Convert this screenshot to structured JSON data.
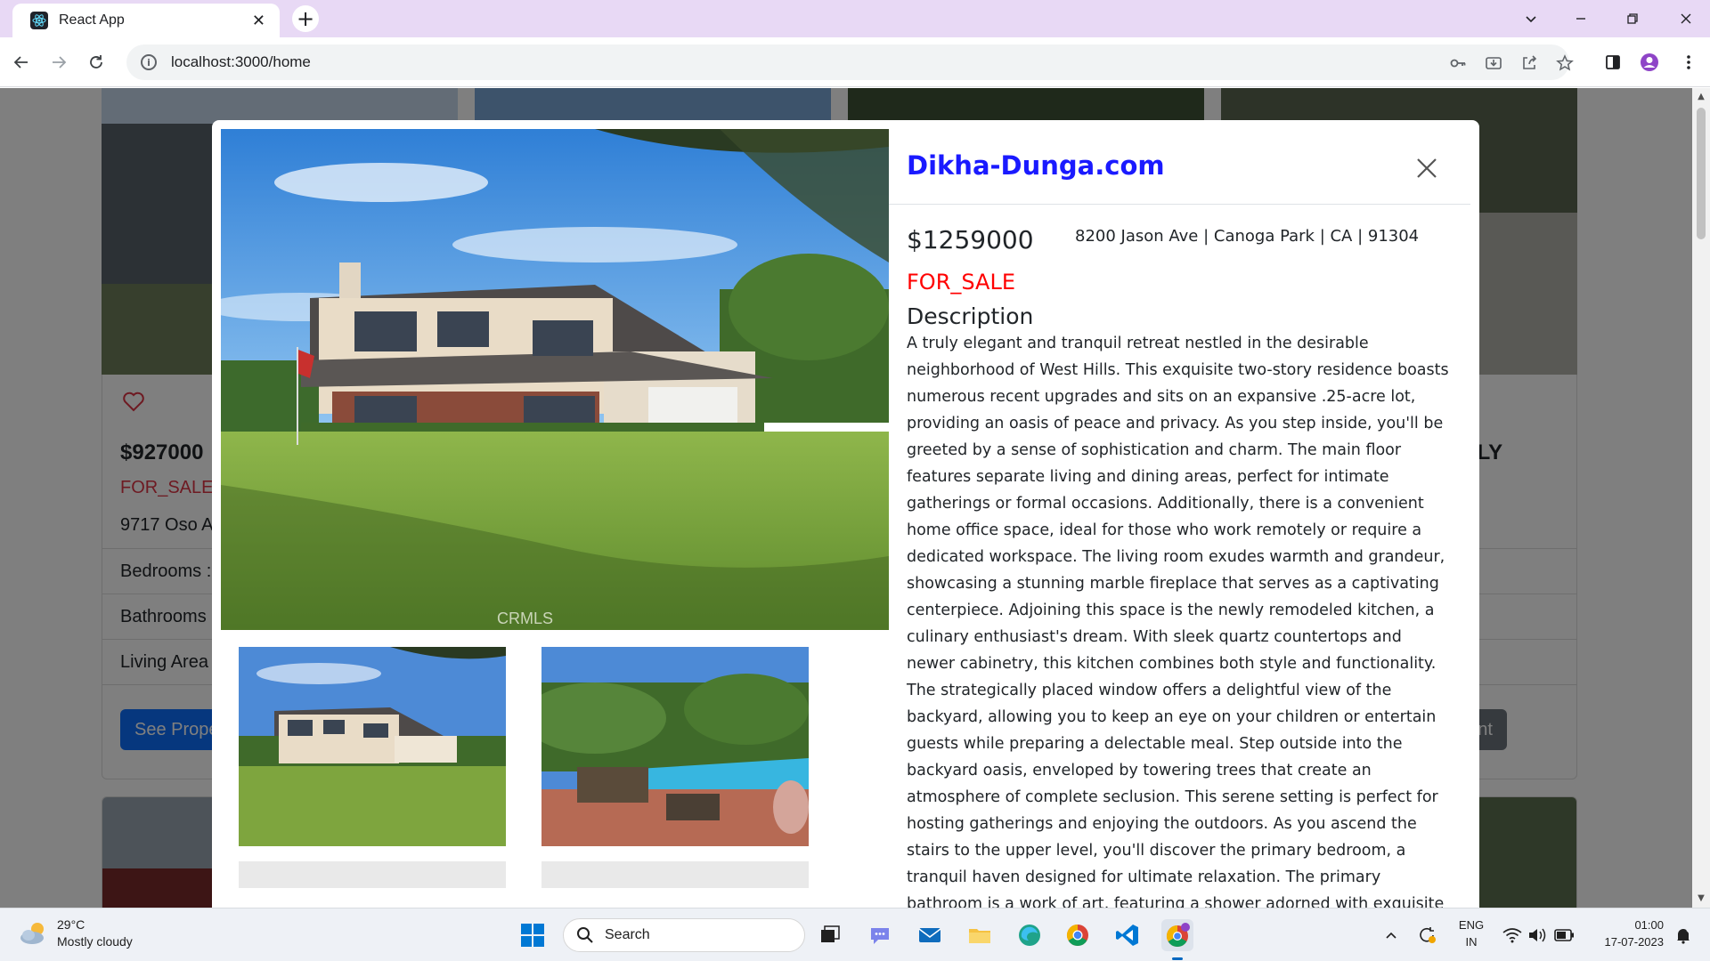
{
  "browser": {
    "tab_title": "React App",
    "url": "localhost:3000/home"
  },
  "background_cards": {
    "left_card": {
      "price": "$927000",
      "status": "FOR_SALE",
      "address": "9717 Oso A",
      "rows": [
        "Bedrooms :",
        "Bathrooms",
        "Living Area"
      ],
      "button": "See Prope"
    },
    "right_card": {
      "type_fragment": "ILY",
      "button": "agent"
    }
  },
  "modal": {
    "brand": "Dikha-Dunga.com",
    "price": "$1259000",
    "address": "8200 Jason Ave | Canoga Park | CA | 91304",
    "status": "FOR_SALE",
    "description_title": "Description",
    "description": "A truly elegant and tranquil retreat nestled in the desirable neighborhood of West Hills. This exquisite two-story residence boasts numerous recent upgrades and sits on an expansive .25-acre lot, providing an oasis of peace and privacy. As you step inside, you'll be greeted by a sense of sophistication and charm. The main floor features separate living and dining areas, perfect for intimate gatherings or formal occasions. Additionally, there is a convenient home office space, ideal for those who work remotely or require a dedicated workspace. The living room exudes warmth and grandeur, showcasing a stunning marble fireplace that serves as a captivating centerpiece. Adjoining this space is the newly remodeled kitchen, a culinary enthusiast's dream. With sleek quartz countertops and newer cabinetry, this kitchen combines both style and functionality. The strategically placed window offers a delightful view of the backyard, allowing you to keep an eye on your children or entertain guests while preparing a delectable meal. Step outside into the backyard oasis, enveloped by towering trees that create an atmosphere of complete seclusion. This serene setting is perfect for hosting gatherings and enjoying the outdoors. As you ascend the stairs to the upper level, you'll discover the primary bedroom, a tranquil haven designed for ultimate relaxation. The primary bathroom is a work of art, featuring a shower adorned with exquisite porcelain tiles",
    "watermark": "CRMLS"
  },
  "taskbar": {
    "weather_temp": "29°C",
    "weather_desc": "Mostly cloudy",
    "search_label": "Search",
    "lang_top": "ENG",
    "lang_bottom": "IN",
    "time": "01:00",
    "date": "17-07-2023"
  },
  "colors": {
    "brand": "#1a1aff",
    "status": "#ff0000",
    "button_primary": "#0d6efd",
    "button_secondary": "#6c757d",
    "tab_strip": "#e8d9f5"
  }
}
